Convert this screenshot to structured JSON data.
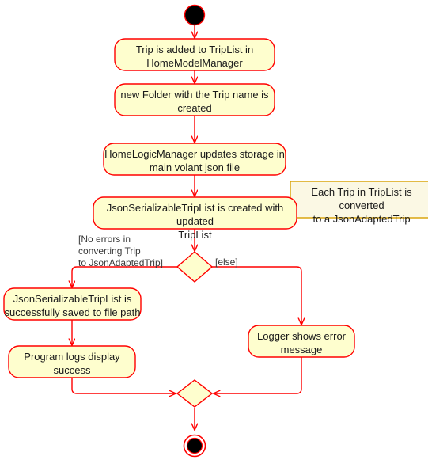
{
  "diagram": {
    "type": "uml-activity-diagram",
    "colors": {
      "activity_fill": "#FEFECE",
      "activity_stroke": "#FF0000",
      "note_fill": "#FBF8E4",
      "note_stroke": "#D8A000",
      "arrow": "#FF0000",
      "start_end_fill": "#000000",
      "text": "#1A1A1A",
      "background": "#FFFFFF"
    },
    "start_node": {
      "name": "start"
    },
    "end_node": {
      "name": "end"
    },
    "activities": [
      {
        "id": "a1",
        "label": "Trip is added to TripList in\nHomeModelManager"
      },
      {
        "id": "a2",
        "label": "new Folder with the Trip name is\ncreated"
      },
      {
        "id": "a3",
        "label": "HomeLogicManager updates storage in\nmain volant json file"
      },
      {
        "id": "a4",
        "label": "JsonSerializableTripList is created with updated\nTripList"
      },
      {
        "id": "a5",
        "label": "JsonSerializableTripList is\nsuccessfully saved to file path"
      },
      {
        "id": "a6",
        "label": "Program logs display\nsuccess"
      },
      {
        "id": "a7",
        "label": "Logger shows error\nmessage"
      }
    ],
    "decision": {
      "id": "d1",
      "guard_yes": "[No errors in\nconverting Trip\nto JsonAdaptedTrip]",
      "guard_else": "[else]"
    },
    "merge": {
      "id": "m1"
    },
    "note": {
      "id": "n1",
      "text": "Each Trip in TripList is converted\nto a JsonAdaptedTrip",
      "attached_to": "a4"
    }
  }
}
